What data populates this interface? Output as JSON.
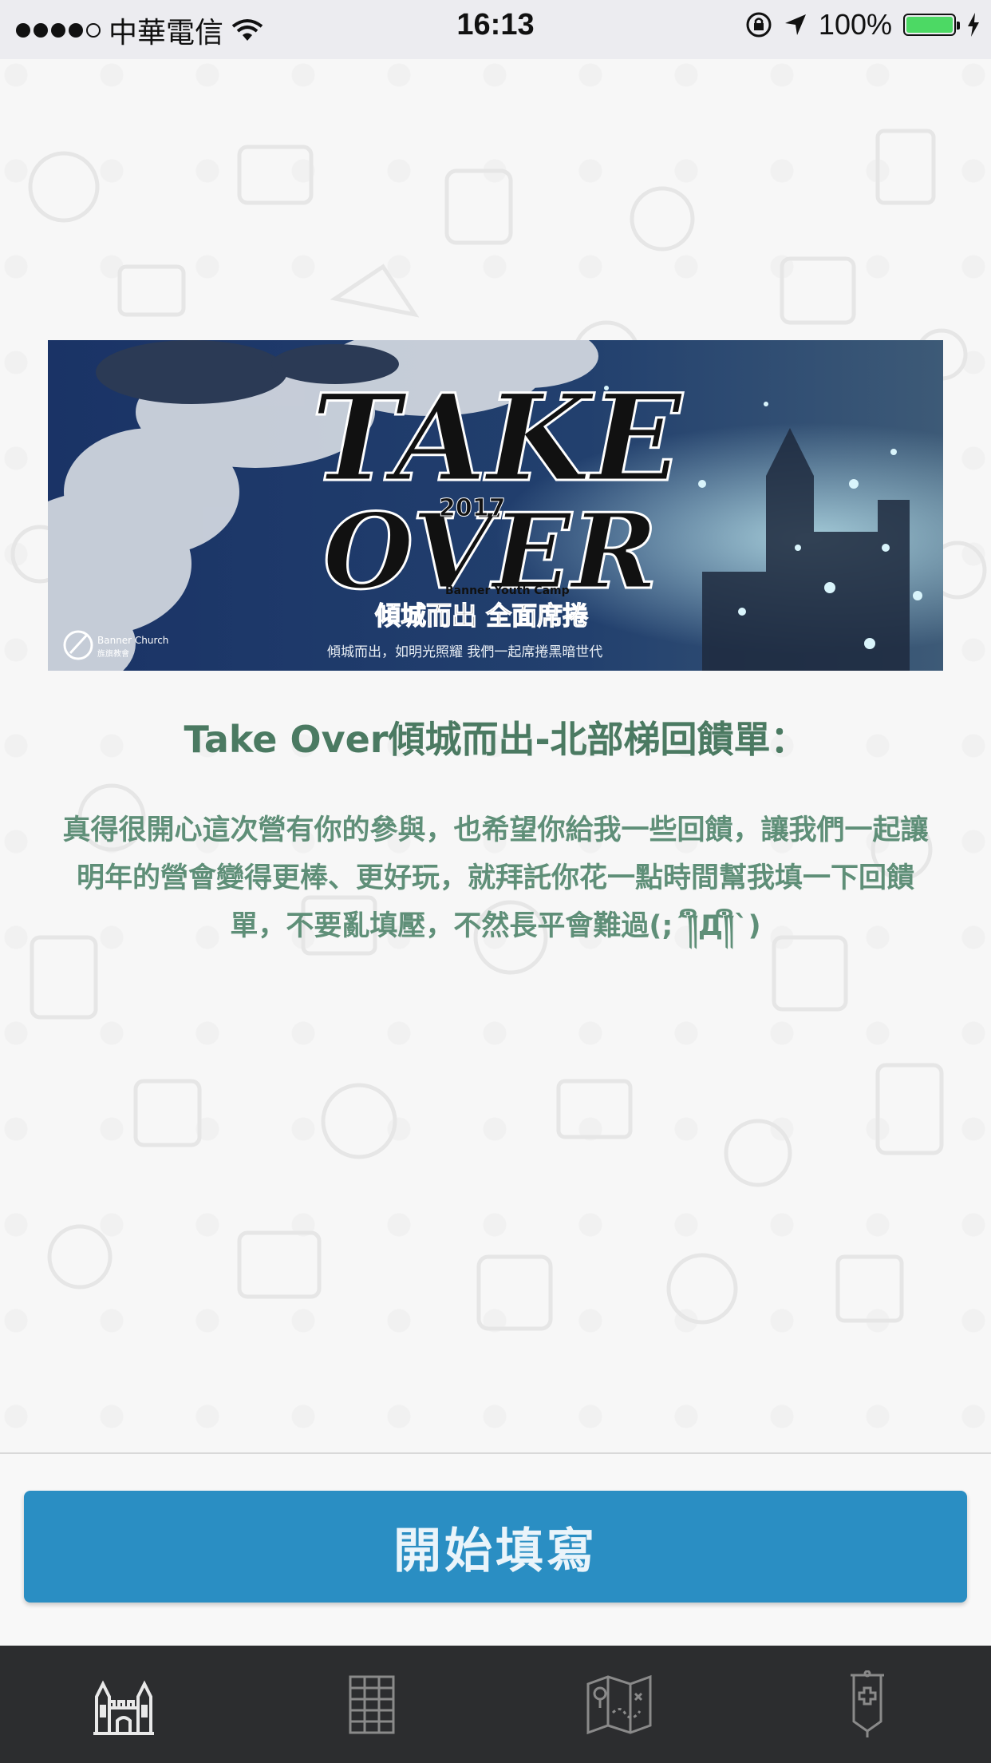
{
  "status_bar": {
    "carrier": "中華電信",
    "time": "16:13",
    "battery": "100%",
    "signal_bars": 4,
    "signal_total": 5
  },
  "banner": {
    "headline_line1": "TAKE",
    "headline_line2": "OVER",
    "year": "2017",
    "event_name": "Banner Youth Camp",
    "slogan": "傾城而出 全面席捲",
    "tagline": "傾城而出，如明光照耀 我們一起席捲黑暗世代",
    "org_name": "Banner Church",
    "org_sub": "旌旗教會"
  },
  "form": {
    "title": "Take Over傾城而出-北部梯回饋單：",
    "description": "真得很開心這次營有你的參與，也希望你給我一些回饋，讓我們一起讓明年的營會變得更棒、更好玩，就拜託你花一點時間幫我填一下回饋單，不要亂填壓，不然長平會難過(;´༎ຶД༎ຶ`)"
  },
  "actions": {
    "start_label": "開始填寫",
    "button_color": "#2a8ec3"
  },
  "tabbar": {
    "tabs": [
      {
        "icon": "castle-icon",
        "active": true
      },
      {
        "icon": "grid-icon",
        "active": false
      },
      {
        "icon": "map-icon",
        "active": false
      },
      {
        "icon": "banner-icon",
        "active": false
      }
    ]
  }
}
